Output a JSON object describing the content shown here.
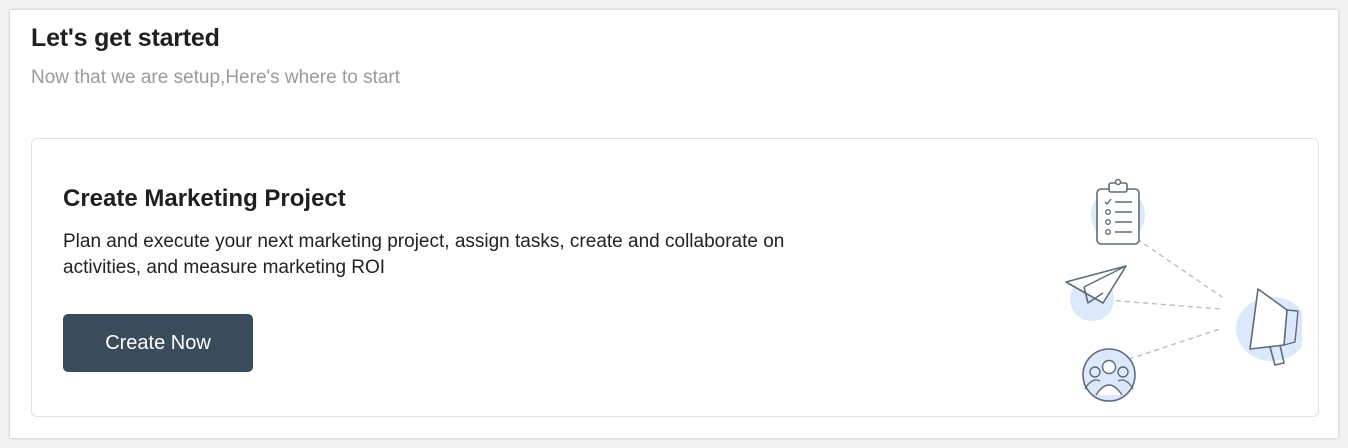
{
  "header": {
    "title": "Let's get started",
    "subtitle": "Now that we are setup,Here's where to start"
  },
  "card": {
    "title": "Create Marketing Project",
    "description": "Plan and execute your next marketing project, assign tasks, create and collaborate on activities, and measure marketing ROI",
    "button_label": "Create Now"
  },
  "illustration": {
    "icons": [
      "clipboard-checklist-icon",
      "paper-plane-icon",
      "people-group-icon",
      "megaphone-icon"
    ]
  },
  "colors": {
    "button_bg": "#3a4b5c",
    "icon_bubble": "#dce8fb",
    "icon_stroke": "#5f6b7a"
  }
}
